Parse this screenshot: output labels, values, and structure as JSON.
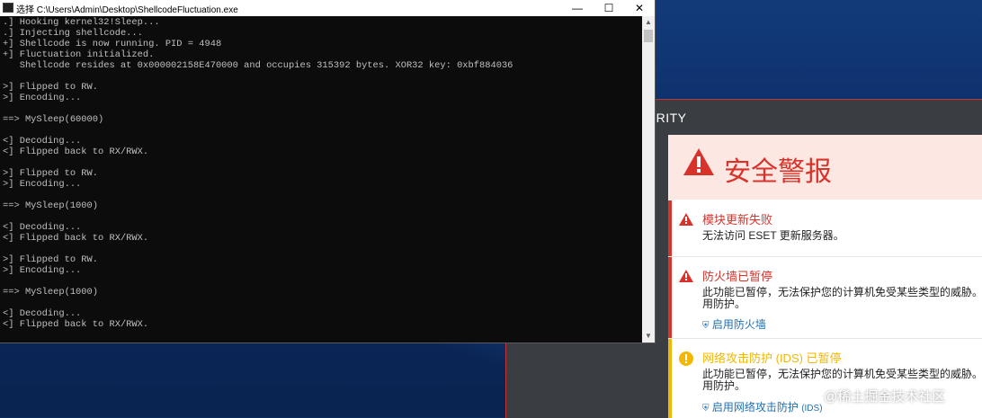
{
  "console": {
    "title": "选择 C:\\Users\\Admin\\Desktop\\ShellcodeFluctuation.exe",
    "buttons": {
      "minimize": "—",
      "maximize": "☐",
      "close": "✕"
    },
    "lines": [
      ".] Hooking kernel32!Sleep...",
      ".] Injecting shellcode...",
      "+] Shellcode is now running. PID = 4948",
      "+] Fluctuation initialized.",
      "   Shellcode resides at 0x000002158E470000 and occupies 315392 bytes. XOR32 key: 0xbf884036",
      "",
      ">] Flipped to RW.",
      ">] Encoding...",
      "",
      "==> MySleep(60000)",
      "",
      "<] Decoding...",
      "<] Flipped back to RX/RWX.",
      "",
      ">] Flipped to RW.",
      ">] Encoding...",
      "",
      "==> MySleep(1000)",
      "",
      "<] Decoding...",
      "<] Flipped back to RX/RWX.",
      "",
      ">] Flipped to RW.",
      ">] Encoding...",
      "",
      "==> MySleep(1000)",
      "",
      "<] Decoding...",
      "<] Flipped back to RX/RWX."
    ]
  },
  "eset": {
    "header_fragment": "URITY",
    "alert_title": "安全警报",
    "alerts": [
      {
        "title": "模块更新失败",
        "description_lines": [
          "无法访问 ESET 更新服务器。"
        ],
        "link": "",
        "link_suffix": "",
        "severity": "error"
      },
      {
        "title": "防火墙已暂停",
        "description_lines": [
          "此功能已暂停，无法保护您的计算机免受某些类型的威胁。 ",
          "用防护。"
        ],
        "link": "启用防火墙",
        "link_suffix": "",
        "severity": "error"
      },
      {
        "title": "网络攻击防护 (IDS) 已暂停",
        "description_lines": [
          "此功能已暂停，无法保护您的计算机免受某些类型的威胁。 ",
          "用防护。"
        ],
        "link": "启用网络攻击防护",
        "link_suffix": "(IDS)",
        "severity": "warning"
      }
    ],
    "colors": {
      "error": "#d8332a",
      "warning": "#f2b705",
      "link": "#1f6fb3"
    }
  },
  "watermark": "@稀土掘金技术社区"
}
